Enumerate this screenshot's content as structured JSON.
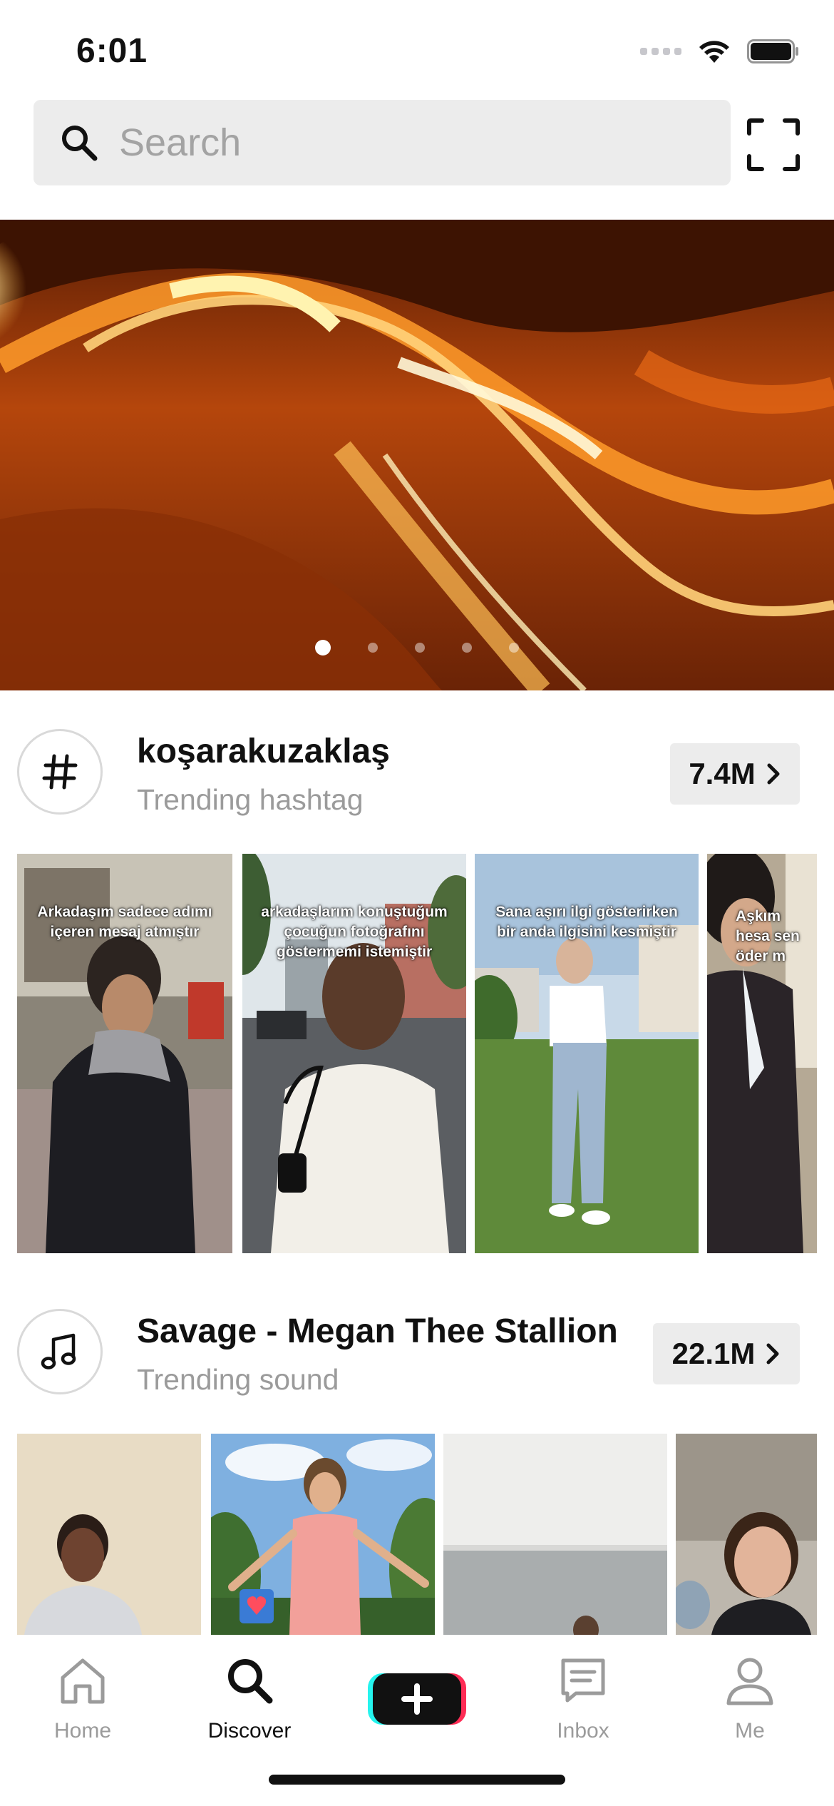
{
  "status_bar": {
    "time": "6:01"
  },
  "search": {
    "placeholder": "Search",
    "value": ""
  },
  "banner": {
    "slide_count": 5,
    "active_slide": 1
  },
  "sections": [
    {
      "type": "hashtag",
      "title": "koşarakuzaklaş",
      "subtitle": "Trending hashtag",
      "count": "7.4M",
      "icon": "hashtag-icon",
      "thumb_captions": [
        "Arkadaşım sadece adımı içeren mesaj atmıştır",
        "arkadaşlarım konuştuğum çocuğun fotoğrafını göstermemi istemiştir",
        "Sana aşırı ilgi gösterirken bir anda ilgisini kesmiştir",
        "Aşkım hesa sen öder m"
      ]
    },
    {
      "type": "sound",
      "title": "Savage - Megan Thee Stallion",
      "subtitle": "Trending sound",
      "count": "22.1M",
      "icon": "music-note-icon",
      "thumb_captions": [
        "",
        "",
        "",
        ""
      ]
    }
  ],
  "tab_bar": {
    "items": [
      {
        "label": "Home",
        "icon": "home-icon",
        "active": false
      },
      {
        "label": "Discover",
        "icon": "search-icon",
        "active": true
      },
      {
        "label": "",
        "icon": "plus-icon",
        "active": false
      },
      {
        "label": "Inbox",
        "icon": "inbox-icon",
        "active": false
      },
      {
        "label": "Me",
        "icon": "person-icon",
        "active": false
      }
    ]
  },
  "colors": {
    "accent_cyan": "#25f4ee",
    "accent_red": "#fe2c55",
    "text_muted": "#9b9b9b",
    "search_bg": "#ececec"
  }
}
